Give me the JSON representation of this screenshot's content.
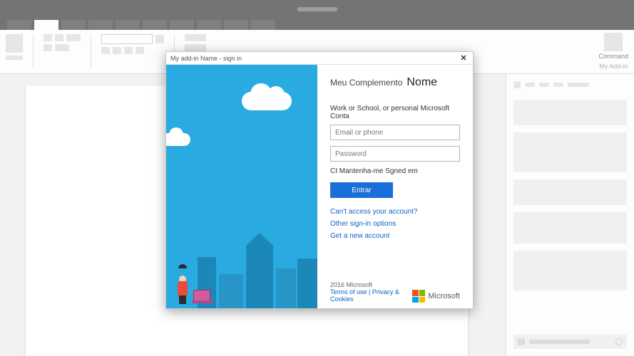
{
  "ribbon": {
    "command_label": "Command",
    "addin_label": "My Add-in"
  },
  "dialog": {
    "title": "My add-in Name - sign in",
    "close": "✕",
    "app_prefix": "Meu Complemento",
    "app_name": "Nome",
    "account_prompt": "Work or School, or personal Microsoft Conta",
    "email_placeholder": "Email or phone",
    "password_placeholder": "Password",
    "keep_signed": "CI Mantenha-me Sgned em",
    "signin_button": "Entrar",
    "links": {
      "cant_access": "Can't access your account?",
      "other_options": "Other sign-in options",
      "new_account": "Get a new account"
    },
    "footer": {
      "copyright": "2016 Microsoft",
      "terms": "Terms of use",
      "sep": " | ",
      "privacy": "Privacy & Cookies",
      "brand": "Microsoft"
    }
  }
}
